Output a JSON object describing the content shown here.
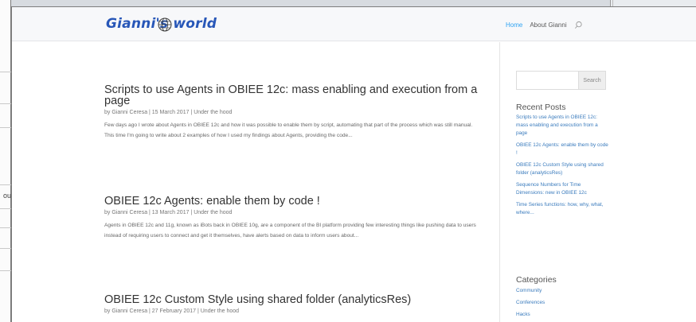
{
  "background": {
    "left_window_text": "ou"
  },
  "header": {
    "logo_text": "Gianni's world",
    "nav": {
      "home": "Home",
      "about": "About Gianni"
    }
  },
  "posts": [
    {
      "title": "Scripts to use Agents in OBIEE 12c: mass enabling and execution from a page",
      "meta": "by Gianni Ceresa | 15 March 2017 | Under the hood",
      "excerpt": "Few days ago I wrote about Agents in OBIEE 12c and how it was possible to enable them by script, automating that part of the process which was still manual. This time I'm going to write about 2 examples of how I used my findings about Agents, providing the code..."
    },
    {
      "title": "OBIEE 12c Agents: enable them by code !",
      "meta": "by Gianni Ceresa | 13 March 2017 | Under the hood",
      "excerpt": "Agents in OBIEE 12c and 11g, known as iBots back in OBIEE 10g, are a component of the BI platform providing few interesting things like pushing data to users instead of requiring users to connect and get it themselves, have alerts based on data to inform users about..."
    },
    {
      "title": "OBIEE 12c Custom Style using shared folder (analyticsRes)",
      "meta": "by Gianni Ceresa | 27 February 2017 | Under the hood"
    }
  ],
  "sidebar": {
    "search": {
      "placeholder": "",
      "button_label": "Search"
    },
    "recent_posts_title": "Recent Posts",
    "recent_posts": [
      "Scripts to use Agents in OBIEE 12c: mass enabling and execution from a page",
      "OBIEE 12c Agents: enable them by code !",
      "OBIEE 12c Custom Style using shared folder (analyticsRes)",
      "Sequence Numbers for Time Dimensions: new in OBIEE 12c",
      "Time Series functions: how, why, what, where..."
    ],
    "categories_title": "Categories",
    "categories": [
      "Community",
      "Conferences",
      "Hacks"
    ]
  },
  "colors": {
    "accent": "#2ea3f2",
    "logo": "#2857b8",
    "sidebar_link": "#3a7bbd"
  }
}
